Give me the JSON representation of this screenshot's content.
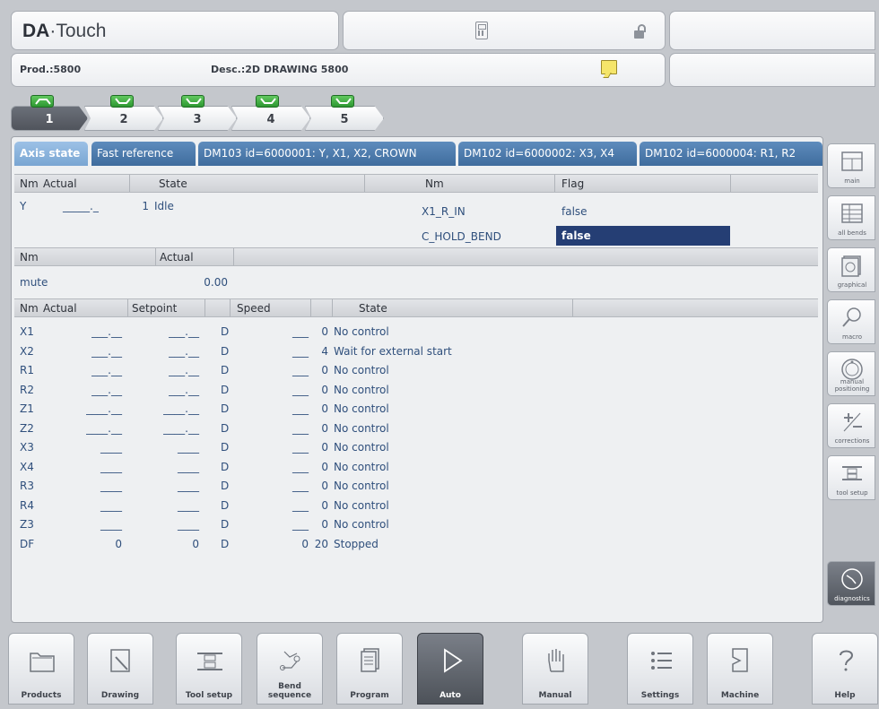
{
  "header": {
    "logo_bold": "DA",
    "logo_rest": "·Touch",
    "product": "Prod.:5800",
    "description": "Desc.:2D DRAWING 5800"
  },
  "steps": [
    "1",
    "2",
    "3",
    "4",
    "5"
  ],
  "tabs": [
    "Axis state",
    "Fast reference",
    "DM103 id=6000001: Y, X1, X2, CROWN",
    "DM102 id=6000002: X3, X4",
    "DM102 id=6000004: R1, R2"
  ],
  "y_table": {
    "headers": [
      "Nm",
      "Actual",
      "State"
    ],
    "row": {
      "nm": "Y",
      "actual": "_____._",
      "state_code": "1",
      "state": "Idle"
    }
  },
  "flag_table": {
    "headers": [
      "Nm",
      "Flag"
    ],
    "rows": [
      {
        "nm": "X1_R_IN",
        "flag": "false"
      },
      {
        "nm": "C_HOLD_BEND",
        "flag": "false"
      }
    ]
  },
  "mute_table": {
    "headers": [
      "Nm",
      "Actual"
    ],
    "row": {
      "nm": "mute",
      "actual": "0.00"
    }
  },
  "axes_table": {
    "headers": [
      "Nm",
      "Actual",
      "Setpoint",
      "Speed",
      "State"
    ],
    "rows": [
      {
        "nm": "X1",
        "actual": "___.__",
        "setpoint": "___.__",
        "mode": "D",
        "speed": "___",
        "code": "0",
        "state": "No control"
      },
      {
        "nm": "X2",
        "actual": "___.__",
        "setpoint": "___.__",
        "mode": "D",
        "speed": "___",
        "code": "4",
        "state": "Wait for external start"
      },
      {
        "nm": "R1",
        "actual": "___.__",
        "setpoint": "___.__",
        "mode": "D",
        "speed": "___",
        "code": "0",
        "state": "No control"
      },
      {
        "nm": "R2",
        "actual": "___.__",
        "setpoint": "___.__",
        "mode": "D",
        "speed": "___",
        "code": "0",
        "state": "No control"
      },
      {
        "nm": "Z1",
        "actual": "____.__",
        "setpoint": "____.__",
        "mode": "D",
        "speed": "___",
        "code": "0",
        "state": "No control"
      },
      {
        "nm": "Z2",
        "actual": "____.__",
        "setpoint": "____.__",
        "mode": "D",
        "speed": "___",
        "code": "0",
        "state": "No control"
      },
      {
        "nm": "X3",
        "actual": "____",
        "setpoint": "____",
        "mode": "D",
        "speed": "___",
        "code": "0",
        "state": "No control"
      },
      {
        "nm": "X4",
        "actual": "____",
        "setpoint": "____",
        "mode": "D",
        "speed": "___",
        "code": "0",
        "state": "No control"
      },
      {
        "nm": "R3",
        "actual": "____",
        "setpoint": "____",
        "mode": "D",
        "speed": "___",
        "code": "0",
        "state": "No control"
      },
      {
        "nm": "R4",
        "actual": "____",
        "setpoint": "____",
        "mode": "D",
        "speed": "___",
        "code": "0",
        "state": "No control"
      },
      {
        "nm": "Z3",
        "actual": "____",
        "setpoint": "____",
        "mode": "D",
        "speed": "___",
        "code": "0",
        "state": "No control"
      },
      {
        "nm": "DF",
        "actual": "0",
        "setpoint": "0",
        "mode": "D",
        "speed": "0",
        "code": "20",
        "state": "Stopped"
      }
    ]
  },
  "sidebar": [
    {
      "label": "main",
      "icon": "main-icon"
    },
    {
      "label": "all bends",
      "icon": "all-bends-icon"
    },
    {
      "label": "graphical",
      "icon": "graphical-icon"
    },
    {
      "label": "macro",
      "icon": "magnifier-icon"
    },
    {
      "label": "manual positioning",
      "icon": "manual-positioning-icon"
    },
    {
      "label": "corrections",
      "icon": "plus-minus-icon"
    },
    {
      "label": "tool setup",
      "icon": "tool-setup-icon"
    },
    {
      "label": "diagnostics",
      "icon": "diagnostics-icon",
      "active": true
    }
  ],
  "bottom_bar": [
    {
      "label": "Products",
      "icon": "folder-icon"
    },
    {
      "label": "Drawing",
      "icon": "pencil-icon"
    },
    {
      "label": "Tool setup",
      "icon": "tool-setup-icon"
    },
    {
      "label": "Bend sequence",
      "icon": "bend-sequence-icon"
    },
    {
      "label": "Program",
      "icon": "document-icon"
    },
    {
      "label": "Auto",
      "icon": "play-icon",
      "active": true
    },
    {
      "label": "Manual",
      "icon": "hand-icon"
    },
    {
      "label": "Settings",
      "icon": "list-icon"
    },
    {
      "label": "Machine",
      "icon": "machine-icon"
    },
    {
      "label": "Help",
      "icon": "question-icon"
    }
  ],
  "colors": {
    "tab_blue": "#4a78aa",
    "selection": "#253e74",
    "value_text": "#2f4f7c",
    "bend_indicator": "#3aa93d"
  }
}
